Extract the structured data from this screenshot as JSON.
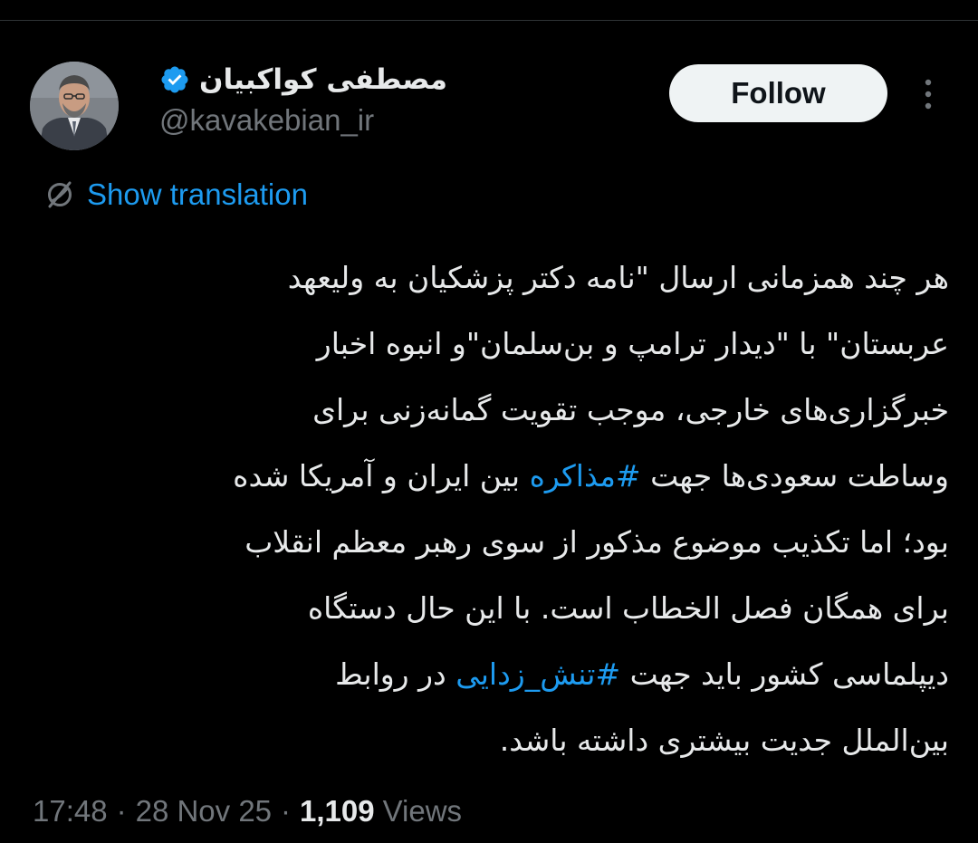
{
  "author": {
    "display_name": "مصطفی کواکبیان",
    "handle": "@kavakebian_ir",
    "verified": true
  },
  "actions": {
    "follow_label": "Follow"
  },
  "translation": {
    "label": "Show translation"
  },
  "tweet": {
    "lines": [
      [
        {
          "text": "هر چند همزمانی ارسال \"نامه دکتر پزشکیان به ولیعهد"
        }
      ],
      [
        {
          "text": "عربستان\" با \"دیدار ترامپ و بن‌سلمان\"و انبوه اخبار"
        }
      ],
      [
        {
          "text": "خبرگزاری‌های خارجی، موجب تقویت گمانه‌زنی برای"
        }
      ],
      [
        {
          "text": "وساطت سعودی‌ها جهت "
        },
        {
          "text": "#مذاکره",
          "hashtag": true
        },
        {
          "text": " بین ایران و آمریکا شده"
        }
      ],
      [
        {
          "text": "بود؛ اما تکذیب موضوع مذکور از سوی رهبر معظم انقلاب"
        }
      ],
      [
        {
          "text": "برای همگان فصل الخطاب است. با این حال دستگاه"
        }
      ],
      [
        {
          "text": "دیپلماسی کشور باید جهت "
        },
        {
          "text": "#تنش_زدایی",
          "hashtag": true
        },
        {
          "text": " در روابط"
        }
      ],
      [
        {
          "text": "بین‌الملل جدیت بیشتری داشته باشد."
        }
      ]
    ]
  },
  "meta": {
    "time": "17:48",
    "separator": "·",
    "date": "28 Nov 25",
    "views_count": "1,109",
    "views_label": "Views"
  },
  "icons": {
    "verified": "verified-badge-icon",
    "more": "more-vertical-icon",
    "translate": "translate-globe-icon"
  },
  "colors": {
    "background": "#000000",
    "text": "#e7e9ea",
    "secondary_text": "#71767b",
    "accent": "#1d9bf0",
    "follow_bg": "#eff3f4",
    "follow_text": "#0f1419"
  }
}
